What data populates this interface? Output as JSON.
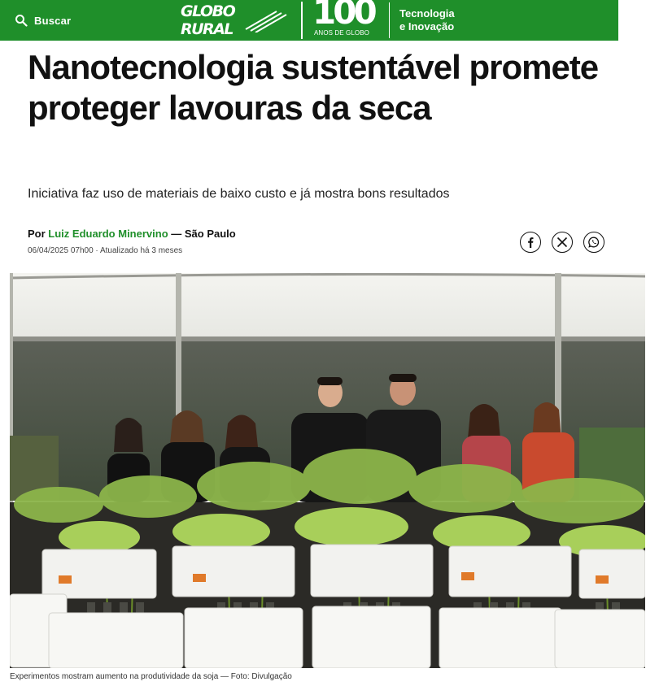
{
  "header": {
    "search_label": "Buscar",
    "logo_text": "GLOBO RURAL",
    "centenary_number": "100",
    "centenary_caption": "ANOS DE GLOBO",
    "section_line1": "Tecnologia",
    "section_line2": "e Inovação",
    "brand_color": "#1f8f2a"
  },
  "article": {
    "title": "Nanotecnologia sustentável promete proteger lavouras da seca",
    "subtitle": "Iniciativa faz uso de materiais de baixo custo e já mostra bons resultados",
    "byline_prefix": "Por",
    "author": "Luiz Eduardo Minervino",
    "location": "— São Paulo",
    "date": "06/04/2025 07h00 · Atualizado há 3 meses",
    "share_icons": [
      "facebook-icon",
      "x-icon",
      "whatsapp-icon"
    ],
    "photo_caption": "Experimentos mostram aumento na produtividade da soja — Foto: Divulgação"
  }
}
